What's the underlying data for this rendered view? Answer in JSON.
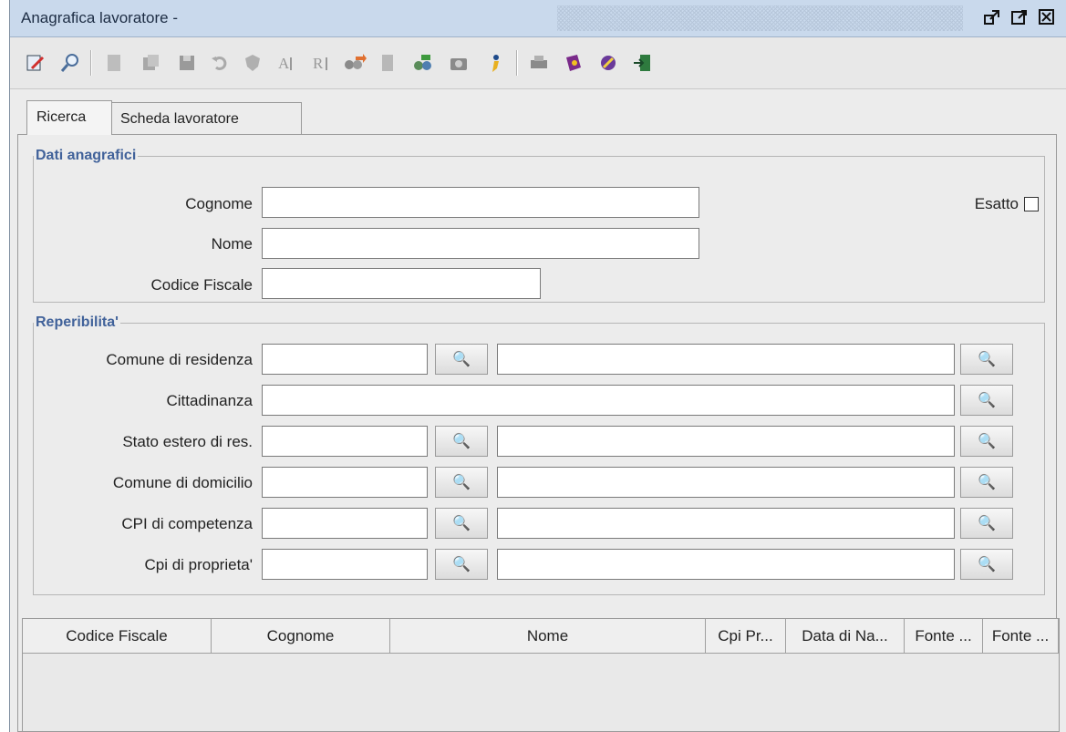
{
  "window": {
    "title": "Anagrafica lavoratore -"
  },
  "titlebar_icons": [
    "restore-icon",
    "maximize-icon",
    "close-icon"
  ],
  "toolbar": {
    "icons": [
      "edit-icon",
      "search-icon",
      "new-document-icon",
      "copy-icon",
      "save-icon",
      "undo-icon",
      "shield-icon",
      "text-a-icon",
      "text-r-icon",
      "binoculars-arrow-icon",
      "document-gray-icon",
      "binoculars-go-icon",
      "camera-icon",
      "info-person-icon",
      "print-icon",
      "help-book-icon",
      "edit-pencil-icon",
      "exit-door-icon"
    ]
  },
  "tabs": [
    {
      "label": "Ricerca"
    },
    {
      "label": "Scheda lavoratore"
    }
  ],
  "dati_anagrafici": {
    "legend": "Dati anagrafici",
    "cognome_label": "Cognome",
    "cognome_value": "",
    "nome_label": "Nome",
    "nome_value": "",
    "cf_label": "Codice Fiscale",
    "cf_value": "",
    "esatto_label": "Esatto",
    "esatto_checked": false
  },
  "reperibilita": {
    "legend": "Reperibilita'",
    "rows": [
      {
        "label": "Comune di residenza",
        "code": "",
        "desc": ""
      },
      {
        "label": "Cittadinanza",
        "desc": ""
      },
      {
        "label": "Stato estero di res.",
        "code": "",
        "desc": ""
      },
      {
        "label": "Comune di domicilio",
        "code": "",
        "desc": ""
      },
      {
        "label": "CPI di competenza",
        "code": "",
        "desc": ""
      },
      {
        "label": "Cpi di proprieta'",
        "code": "",
        "desc": ""
      }
    ]
  },
  "results_table": {
    "columns": [
      "Codice Fiscale",
      "Cognome",
      "Nome",
      "Cpi Pr...",
      "Data di Na...",
      "Fonte ...",
      "Fonte ..."
    ],
    "rows": []
  },
  "colors": {
    "accent": "#41629a",
    "titlebar": "#c9d9ec"
  }
}
